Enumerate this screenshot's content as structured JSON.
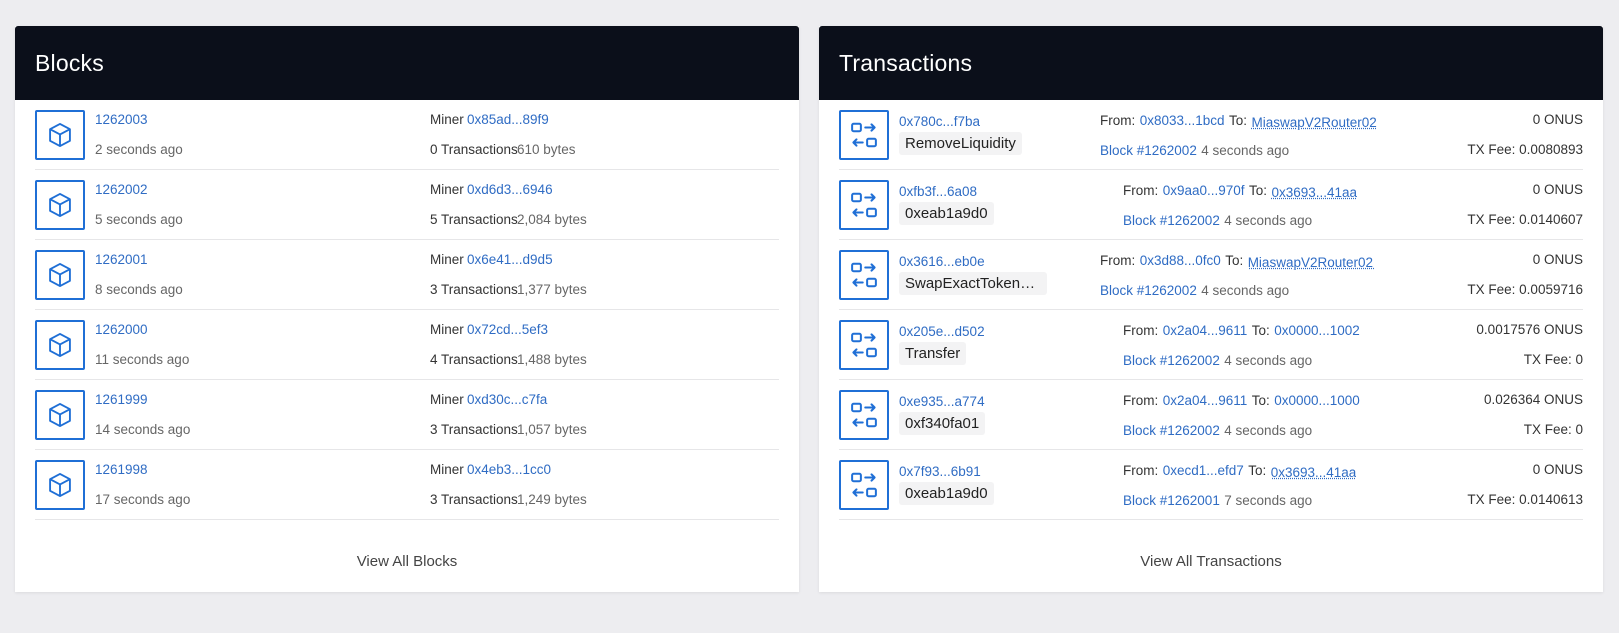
{
  "blocks_panel": {
    "title": "Blocks",
    "view_all": "View All Blocks",
    "miner_label": "Miner",
    "items": [
      {
        "number": "1262003",
        "age": "2 seconds ago",
        "miner": "0x85ad...89f9",
        "tx_count": "0 Transactions",
        "size": "610 bytes"
      },
      {
        "number": "1262002",
        "age": "5 seconds ago",
        "miner": "0xd6d3...6946",
        "tx_count": "5 Transactions",
        "size": "2,084 bytes"
      },
      {
        "number": "1262001",
        "age": "8 seconds ago",
        "miner": "0x6e41...d9d5",
        "tx_count": "3 Transactions",
        "size": "1,377 bytes"
      },
      {
        "number": "1262000",
        "age": "11 seconds ago",
        "miner": "0x72cd...5ef3",
        "tx_count": "4 Transactions",
        "size": "1,488 bytes"
      },
      {
        "number": "1261999",
        "age": "14 seconds ago",
        "miner": "0xd30c...c7fa",
        "tx_count": "3 Transactions",
        "size": "1,057 bytes"
      },
      {
        "number": "1261998",
        "age": "17 seconds ago",
        "miner": "0x4eb3...1cc0",
        "tx_count": "3 Transactions",
        "size": "1,249 bytes"
      }
    ]
  },
  "transactions_panel": {
    "title": "Transactions",
    "view_all": "View All Transactions",
    "from_label": "From:",
    "to_label": "To:",
    "items": [
      {
        "hash": "0x780c...f7ba",
        "method": "RemoveLiquidity",
        "from": "0x8033...1bcd",
        "to": "MiaswapV2Router02 (",
        "block": "Block #1262002",
        "age": "4 seconds ago",
        "value": "0 ONUS",
        "fee": "TX Fee: 0.0080893"
      },
      {
        "hash": "0xfb3f...6a08",
        "method": "0xeab1a9d0",
        "from": "0x9aa0...970f",
        "to": "0x3693...41aa",
        "block": "Block #1262002",
        "age": "4 seconds ago",
        "value": "0 ONUS",
        "fee": "TX Fee: 0.0140607"
      },
      {
        "hash": "0x3616...eb0e",
        "method": "SwapExactTokensF...",
        "from": "0x3d88...0fc0",
        "to": "MiaswapV2Router02 (",
        "block": "Block #1262002",
        "age": "4 seconds ago",
        "value": "0 ONUS",
        "fee": "TX Fee: 0.0059716"
      },
      {
        "hash": "0x205e...d502",
        "method": "Transfer",
        "from": "0x2a04...9611",
        "to": "0x0000...1002",
        "block": "Block #1262002",
        "age": "4 seconds ago",
        "value": "0.0017576 ONUS",
        "fee": "TX Fee: 0"
      },
      {
        "hash": "0xe935...a774",
        "method": "0xf340fa01",
        "from": "0x2a04...9611",
        "to": "0x0000...1000",
        "block": "Block #1262002",
        "age": "4 seconds ago",
        "value": "0.026364 ONUS",
        "fee": "TX Fee: 0"
      },
      {
        "hash": "0x7f93...6b91",
        "method": "0xeab1a9d0",
        "from": "0xecd1...efd7",
        "to": "0x3693...41aa",
        "block": "Block #1262001",
        "age": "7 seconds ago",
        "value": "0 ONUS",
        "fee": "TX Fee: 0.0140613"
      }
    ]
  },
  "colors": {
    "accent": "#1f6fd6",
    "link": "#2f6cc4",
    "header_bg": "#0b0f1a",
    "page_bg": "#ededf0"
  },
  "icons": {
    "block": "cube-icon",
    "transaction": "transfer-arrows-icon"
  }
}
